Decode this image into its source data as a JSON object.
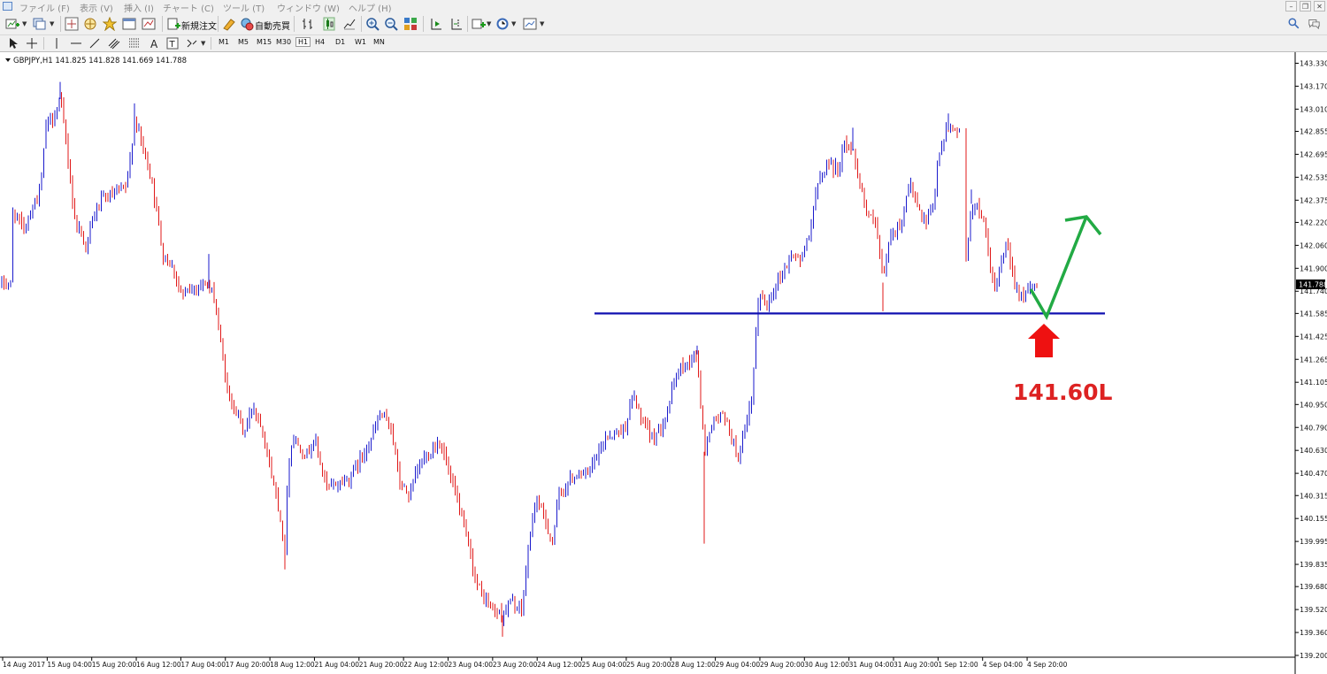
{
  "menu": {
    "items": [
      "ファイル (F)",
      "表示 (V)",
      "挿入 (I)",
      "チャート (C)",
      "ツール (T)",
      "ウィンドウ (W)",
      "ヘルプ (H)"
    ]
  },
  "toolbar": {
    "new_order_label": "新規注文",
    "auto_trading_label": "自動売買",
    "timeframes": [
      "M1",
      "M5",
      "M15",
      "M30",
      "H1",
      "H4",
      "D1",
      "W1",
      "MN"
    ],
    "active_timeframe": "H1"
  },
  "chart": {
    "header": "GBPJPY,H1  141.825 141.828 141.669 141.788",
    "current_price_label": "141.788",
    "annotation_text": "141.60L",
    "price_ticks": [
      "143.330",
      "143.170",
      "143.010",
      "142.855",
      "142.695",
      "142.535",
      "142.375",
      "142.220",
      "142.060",
      "141.900",
      "141.740",
      "141.585",
      "141.425",
      "141.265",
      "141.105",
      "140.950",
      "140.790",
      "140.630",
      "140.470",
      "140.315",
      "140.155",
      "139.995",
      "139.835",
      "139.680",
      "139.520",
      "139.360",
      "139.200"
    ],
    "time_ticks": [
      "14 Aug 2017",
      "15 Aug 04:00",
      "15 Aug 20:00",
      "16 Aug 12:00",
      "17 Aug 04:00",
      "17 Aug 20:00",
      "18 Aug 12:00",
      "21 Aug 04:00",
      "21 Aug 20:00",
      "22 Aug 12:00",
      "23 Aug 04:00",
      "23 Aug 20:00",
      "24 Aug 12:00",
      "25 Aug 04:00",
      "25 Aug 20:00",
      "28 Aug 12:00",
      "29 Aug 04:00",
      "29 Aug 20:00",
      "30 Aug 12:00",
      "31 Aug 04:00",
      "31 Aug 20:00",
      "1 Sep 12:00",
      "4 Sep 04:00",
      "4 Sep 20:00"
    ],
    "support_level": 141.585,
    "colors": {
      "up": "#1a1acc",
      "down": "#e01818",
      "support_line": "#1010b0",
      "target_arrow": "#22aa44",
      "support_arrow": "#ee1111",
      "annotation": "#dd2222"
    }
  },
  "chart_data": {
    "type": "candlestick",
    "symbol": "GBPJPY",
    "timeframe": "H1",
    "ylim": [
      139.2,
      143.33
    ],
    "path": [
      [
        14,
        142.3
      ],
      [
        26,
        142.18
      ],
      [
        46,
        142.45
      ],
      [
        52,
        142.9
      ],
      [
        60,
        142.95
      ],
      [
        68,
        143.08
      ],
      [
        76,
        142.72
      ],
      [
        84,
        142.25
      ],
      [
        98,
        142.05
      ],
      [
        106,
        142.28
      ],
      [
        116,
        142.38
      ],
      [
        132,
        142.42
      ],
      [
        144,
        142.48
      ],
      [
        152,
        142.95
      ],
      [
        160,
        142.78
      ],
      [
        172,
        142.5
      ],
      [
        184,
        142.0
      ],
      [
        196,
        141.9
      ],
      [
        206,
        141.7
      ],
      [
        222,
        141.78
      ],
      [
        232,
        141.8
      ],
      [
        242,
        141.7
      ],
      [
        250,
        141.35
      ],
      [
        258,
        141.0
      ],
      [
        268,
        140.9
      ],
      [
        276,
        140.75
      ],
      [
        286,
        140.95
      ],
      [
        296,
        140.8
      ],
      [
        304,
        140.55
      ],
      [
        316,
        140.2
      ],
      [
        322,
        139.92
      ],
      [
        324,
        140.35
      ],
      [
        330,
        140.72
      ],
      [
        346,
        140.6
      ],
      [
        356,
        140.7
      ],
      [
        370,
        140.35
      ],
      [
        380,
        140.4
      ],
      [
        392,
        140.42
      ],
      [
        406,
        140.55
      ],
      [
        420,
        140.72
      ],
      [
        430,
        140.88
      ],
      [
        442,
        140.8
      ],
      [
        452,
        140.4
      ],
      [
        462,
        140.32
      ],
      [
        476,
        140.55
      ],
      [
        486,
        140.62
      ],
      [
        498,
        140.7
      ],
      [
        508,
        140.45
      ],
      [
        518,
        140.25
      ],
      [
        528,
        140.0
      ],
      [
        538,
        139.72
      ],
      [
        546,
        139.6
      ],
      [
        558,
        139.52
      ],
      [
        568,
        139.48
      ],
      [
        578,
        139.58
      ],
      [
        590,
        139.5
      ],
      [
        598,
        140.0
      ],
      [
        606,
        140.3
      ],
      [
        616,
        140.15
      ],
      [
        624,
        139.98
      ],
      [
        632,
        140.32
      ],
      [
        642,
        140.4
      ],
      [
        654,
        140.48
      ],
      [
        664,
        140.46
      ],
      [
        676,
        140.6
      ],
      [
        684,
        140.72
      ],
      [
        694,
        140.75
      ],
      [
        706,
        140.78
      ],
      [
        716,
        141.02
      ],
      [
        726,
        140.82
      ],
      [
        736,
        140.72
      ],
      [
        746,
        140.78
      ],
      [
        756,
        140.95
      ],
      [
        766,
        141.18
      ],
      [
        778,
        141.25
      ],
      [
        788,
        141.3
      ],
      [
        796,
        140.62
      ],
      [
        804,
        140.82
      ],
      [
        816,
        140.88
      ],
      [
        824,
        140.78
      ],
      [
        834,
        140.58
      ],
      [
        842,
        140.75
      ],
      [
        850,
        141.0
      ],
      [
        858,
        141.75
      ],
      [
        866,
        141.62
      ],
      [
        876,
        141.78
      ],
      [
        886,
        141.88
      ],
      [
        896,
        142.0
      ],
      [
        906,
        141.95
      ],
      [
        916,
        142.2
      ],
      [
        926,
        142.52
      ],
      [
        936,
        142.65
      ],
      [
        946,
        142.58
      ],
      [
        956,
        142.78
      ],
      [
        964,
        142.72
      ],
      [
        972,
        142.5
      ],
      [
        980,
        142.28
      ],
      [
        990,
        142.2
      ],
      [
        998,
        141.8
      ],
      [
        1006,
        142.12
      ],
      [
        1018,
        142.2
      ],
      [
        1028,
        142.5
      ],
      [
        1038,
        142.3
      ],
      [
        1046,
        142.2
      ],
      [
        1054,
        142.3
      ],
      [
        1062,
        142.72
      ],
      [
        1070,
        142.86
      ],
      [
        1078,
        142.88
      ],
      [
        1086,
        142.86
      ],
      [
        1092,
        141.95
      ],
      [
        1098,
        142.35
      ],
      [
        1110,
        142.28
      ],
      [
        1118,
        141.98
      ],
      [
        1124,
        141.72
      ],
      [
        1132,
        141.95
      ],
      [
        1138,
        142.05
      ],
      [
        1146,
        141.82
      ],
      [
        1156,
        141.7
      ],
      [
        1166,
        141.75
      ],
      [
        1172,
        141.79
      ]
    ]
  }
}
